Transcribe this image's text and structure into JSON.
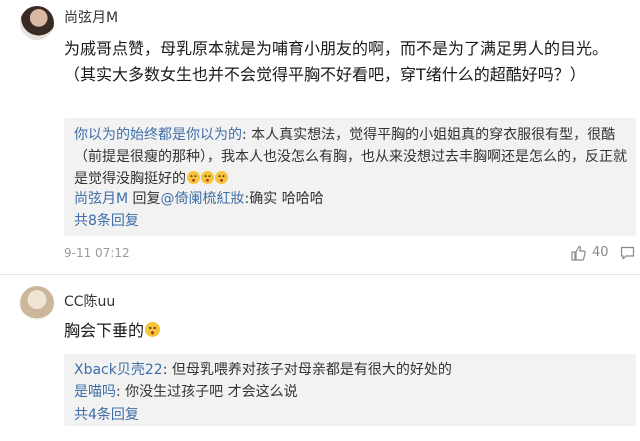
{
  "comments": [
    {
      "username": "尚弦月M",
      "text": "为戚哥点赞，母乳原本就是为哺育小朋友的啊，而不是为了满足男人的目光。（其实大多数女生也并不会觉得平胸不好看吧，穿T绪什么的超酷好吗？）",
      "replies": [
        {
          "author": "你以为的始终都是你以为的",
          "text": ": 本人真实想法，觉得平胸的小姐姐真的穿衣服很有型，很酷（前提是很瘦的那种），我本人也没怎么有胸，也从来没想过去丰胸啊还是怎么的，反正就是觉得没胸挺好的",
          "emoji": [
            "laugh-cry-emoji",
            "laugh-cry-emoji",
            "laugh-cry-emoji"
          ]
        },
        {
          "author": "尚弦月M",
          "reply_word": " 回复",
          "target": "@倚阑梳紅妝",
          "text": ":确实 哈哈哈"
        }
      ],
      "more_replies": "共8条回复",
      "time": "9-11 07:12",
      "likes": "40"
    },
    {
      "username": "CC陈uu",
      "text": "胸会下垂的",
      "emoji": [
        "sweat-emoji"
      ],
      "replies": [
        {
          "author": "Xback贝壳22",
          "text": ": 但母乳喂养对孩子对母亲都是有很大的好处的"
        },
        {
          "author": "是喵吗",
          "text": ": 你没生过孩子吧 才会这么说"
        }
      ],
      "more_replies": "共4条回复"
    }
  ],
  "colors": {
    "link": "#3f6ea8",
    "reply_bg": "#f2f2f2",
    "meta": "#999999"
  },
  "icons": [
    "thumb-up-icon",
    "comment-icon"
  ]
}
